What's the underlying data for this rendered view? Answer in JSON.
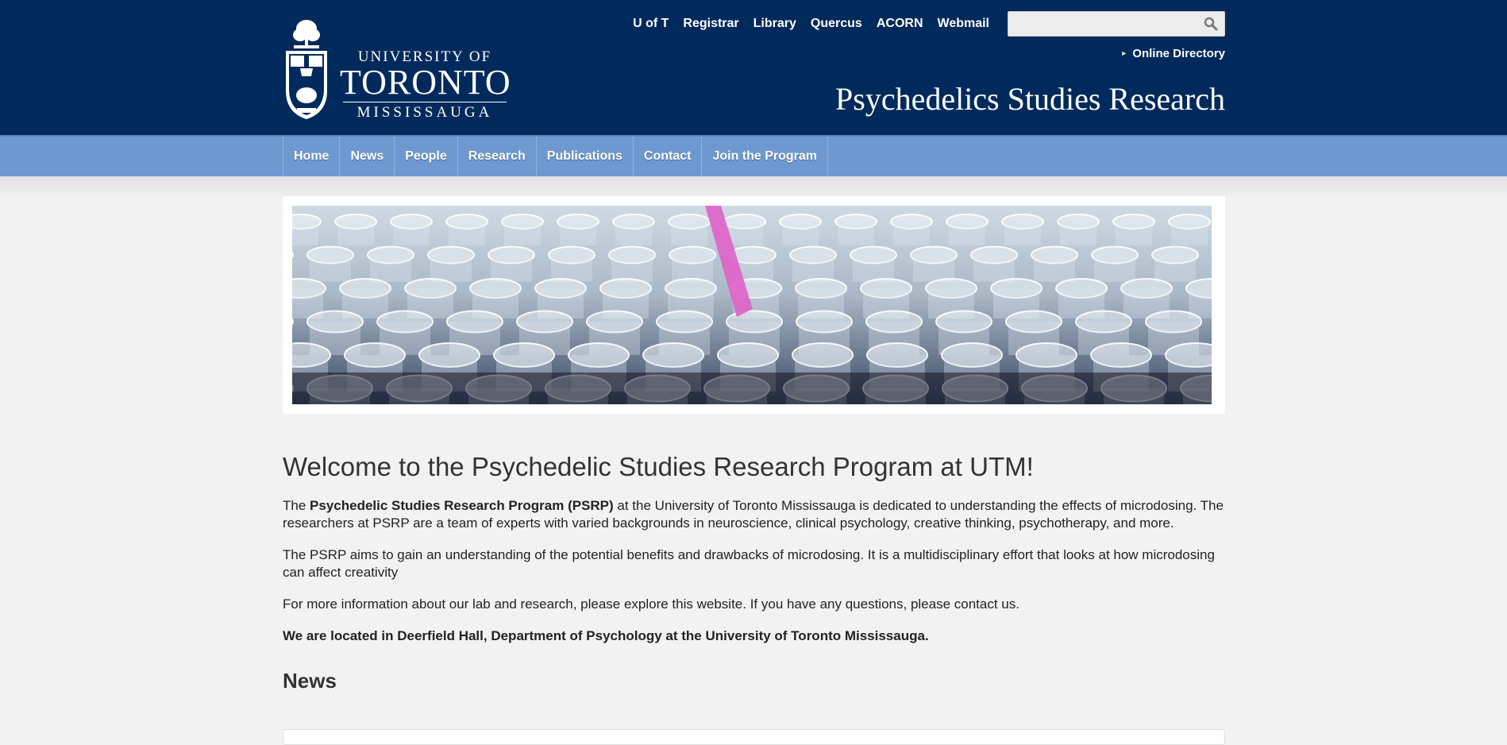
{
  "header": {
    "logo": {
      "line1": "UNIVERSITY OF",
      "line2": "TORONTO",
      "line3": "MISSISSAUGA"
    },
    "top_links": [
      "U of T",
      "Registrar",
      "Library",
      "Quercus",
      "ACORN",
      "Webmail"
    ],
    "search": {
      "placeholder": "",
      "value": ""
    },
    "online_directory": "Online Directory",
    "site_title": "Psychedelics Studies Research"
  },
  "nav": {
    "items": [
      "Home",
      "News",
      "People",
      "Research",
      "Publications",
      "Contact",
      "Join the Program"
    ]
  },
  "main": {
    "heading": "Welcome to the Psychedelic Studies Research Program at UTM!",
    "p1_pre": "The ",
    "p1_bold": "Psychedelic Studies Research Program (PSRP)",
    "p1_post": " at the University of Toronto Mississauga is dedicated to understanding the effects of microdosing. The researchers at PSRP are a team of experts with varied backgrounds in neuroscience, clinical psychology, creative thinking, psychotherapy, and more.",
    "p2": "The PSRP aims to gain an understanding of the potential benefits and drawbacks of microdosing. It is a multidisciplinary effort that looks at how microdosing can affect creativity",
    "p3": "For more information about our lab and research, please explore this website. If you have any questions, please contact us.",
    "p4": "We are located in Deerfield Hall, Department of Psychology at the University of Toronto Mississauga.",
    "news_heading": "News"
  },
  "colors": {
    "header_bg": "#002a5c",
    "nav_bg": "#6e99d0",
    "page_bg": "#f2f2f2"
  }
}
